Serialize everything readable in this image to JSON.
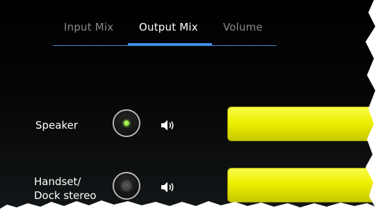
{
  "tabs": [
    {
      "label": "Input Mix",
      "active": false
    },
    {
      "label": "Output Mix",
      "active": true
    },
    {
      "label": "Volume",
      "active": false
    }
  ],
  "outputs": [
    {
      "label_line1": "Speaker",
      "label_line2": "",
      "selected": true,
      "icon": "speaker-icon"
    },
    {
      "label_line1": "Handset/",
      "label_line2": "Dock stereo",
      "selected": false,
      "icon": "speaker-icon"
    }
  ],
  "colors": {
    "accent": "#3f8ff0",
    "slider": "#eef000",
    "indicator": "#6ad11a"
  }
}
